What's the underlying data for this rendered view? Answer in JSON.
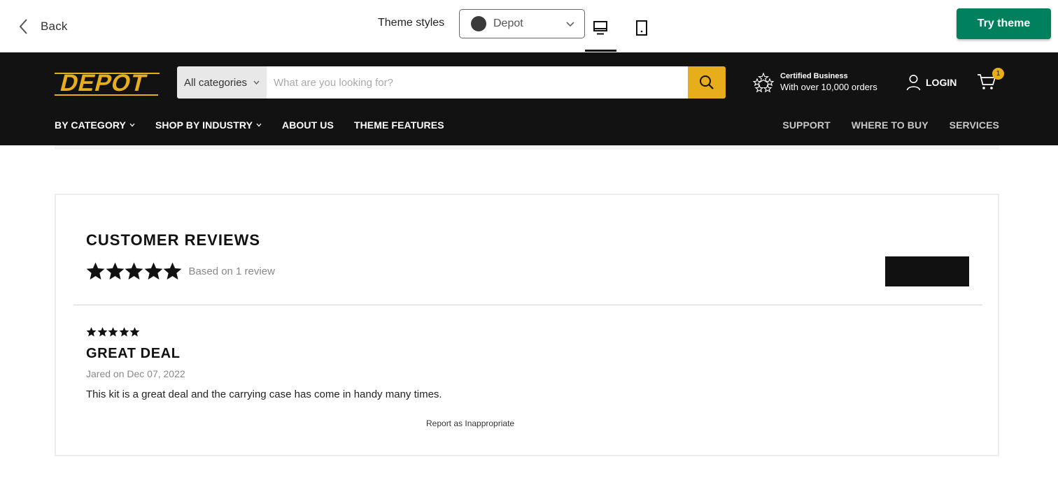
{
  "preview_bar": {
    "back_label": "Back",
    "theme_styles_label": "Theme styles",
    "theme_style_selected": "Depot",
    "theme_swatch_color": "#3b3b3b",
    "try_theme_label": "Try theme",
    "try_theme_color": "#00805d"
  },
  "store_header": {
    "logo_text": "DEPOT",
    "brand_color": "#e8ad1a",
    "search": {
      "category_selected": "All categories",
      "placeholder": "What are you looking for?"
    },
    "certified": {
      "title": "Certified Business",
      "subtitle": "With over 10,000 orders"
    },
    "login_label": "LOGIN",
    "cart_count": "1",
    "nav_left": [
      "BY CATEGORY",
      "SHOP BY INDUSTRY",
      "ABOUT US",
      "THEME FEATURES"
    ],
    "nav_right": [
      "SUPPORT",
      "WHERE TO BUY",
      "SERVICES"
    ]
  },
  "reviews": {
    "title": "CUSTOMER REVIEWS",
    "average_rating": 5,
    "based_on": "Based on 1 review",
    "items": [
      {
        "rating": 5,
        "title": "GREAT DEAL",
        "meta": "Jared on Dec 07, 2022",
        "body": "This kit is a great deal and the carrying case has come in handy many times."
      }
    ],
    "report_label": "Report as Inappropriate"
  }
}
